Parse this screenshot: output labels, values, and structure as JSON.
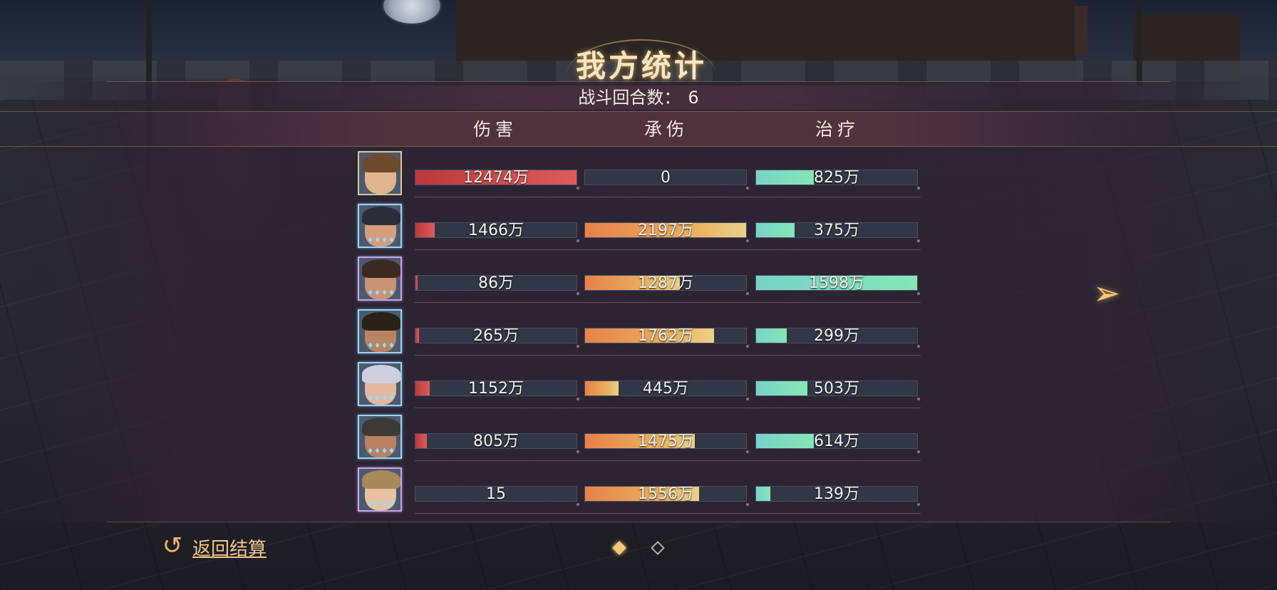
{
  "header": {
    "title": "我方统计",
    "rounds_label": "战斗回合数：",
    "rounds_value": "6"
  },
  "columns": {
    "damage": "伤害",
    "taken": "承伤",
    "healing": "治疗"
  },
  "colors": {
    "damage_bar": "#d04a4e",
    "taken_bar": "#e8904f",
    "healing_bar": "#7ddcc4",
    "accent_gold": "#f2c77a"
  },
  "heroes": [
    {
      "frame": "gold",
      "damage": "12474万",
      "damage_fill": 1.0,
      "taken": "0",
      "taken_fill": 0.0,
      "healing": "825万",
      "healing_fill": 0.36
    },
    {
      "frame": "blue",
      "damage": "1466万",
      "damage_fill": 0.12,
      "taken": "2197万",
      "taken_fill": 1.0,
      "healing": "375万",
      "healing_fill": 0.24
    },
    {
      "frame": "purple",
      "damage": "86万",
      "damage_fill": 0.01,
      "taken": "1287万",
      "taken_fill": 0.59,
      "healing": "1598万",
      "healing_fill": 1.0
    },
    {
      "frame": "blue",
      "damage": "265万",
      "damage_fill": 0.02,
      "taken": "1762万",
      "taken_fill": 0.8,
      "healing": "299万",
      "healing_fill": 0.19
    },
    {
      "frame": "blue",
      "damage": "1152万",
      "damage_fill": 0.09,
      "taken": "445万",
      "taken_fill": 0.21,
      "healing": "503万",
      "healing_fill": 0.32
    },
    {
      "frame": "blue",
      "damage": "805万",
      "damage_fill": 0.07,
      "taken": "1475万",
      "taken_fill": 0.68,
      "healing": "614万",
      "healing_fill": 0.36
    },
    {
      "frame": "purple",
      "damage": "15",
      "damage_fill": 0.0,
      "taken": "1556万",
      "taken_fill": 0.71,
      "healing": "139万",
      "healing_fill": 0.09
    }
  ],
  "footer": {
    "return_label": "返回结算",
    "return_icon": "return-arrow-icon",
    "next_icon": "next-page-arrow-icon",
    "page_index": 1,
    "page_count": 2
  }
}
